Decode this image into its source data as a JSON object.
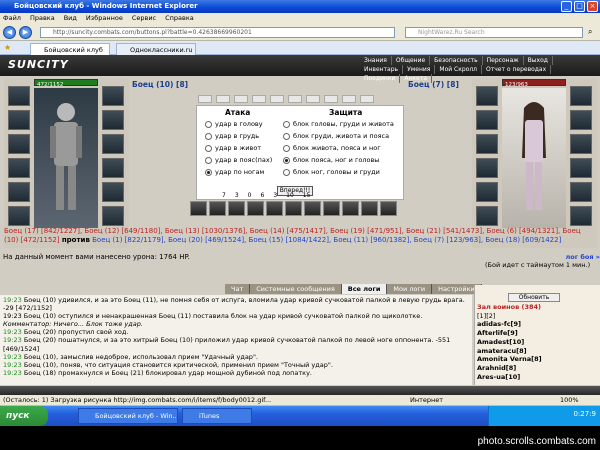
{
  "window": {
    "title": "Бойцовский клуб - Windows Internet Explorer"
  },
  "menu": [
    "Файл",
    "Правка",
    "Вид",
    "Избранное",
    "Сервис",
    "Справка"
  ],
  "address": {
    "url": "http://suncity.combats.com/buttons.pl?battle=0.42638669960201",
    "search_placeholder": "NightWarez.Ru Search"
  },
  "tabs": [
    {
      "label": "Бойцовский клуб"
    },
    {
      "label": "Одноклассники.ru"
    }
  ],
  "game": {
    "logo": "SUNCITY",
    "topnav": [
      "Знания",
      "Общение",
      "Безопасность",
      "Персонаж",
      "Выход",
      "Инвентарь",
      "Умения",
      "Мой Скролл",
      "Отчет о переводах",
      "Поединки",
      "Анкета"
    ],
    "left_hp": "472/1152",
    "right_hp": "123/963",
    "left_name": "Боец (10) [8]",
    "right_name": "Боец (7) [8]",
    "attack_title": "Атака",
    "defense_title": "Защита",
    "attacks": [
      "удар в голову",
      "удар в грудь",
      "удар в живот",
      "удар в пояс(пах)",
      "удар по ногам"
    ],
    "defenses": [
      "блок головы, груди и живота",
      "блок груди, живота и пояса",
      "блок живота, пояса и ног",
      "блок пояса, ног и головы",
      "блок ног, головы и груди"
    ],
    "fight_button": "Вперед!!!",
    "stats": [
      "7",
      "3",
      "0",
      "6",
      "3",
      "10",
      "15"
    ],
    "team_line1": "Боец (17) [842/1227], Боец (12) [649/1180], Боец (13) [1030/1376], Боец (14) [475/1417], Боец (19) [471/951], Боец (21) [541/1473], Боец (6) [494/1321], Боец",
    "team_line2_red": "(10) [472/1152]",
    "team_line2_vs": "против",
    "team_line2_blue": "Боец (1) [822/1179], Боец (20) [469/1524], Боец (15) [1084/1422], Боец (11) [960/1382], Боец (7) [123/963], Боец (18) [609/1422]",
    "damage": "На данный момент вами нанесено урона: 1764 HP.",
    "timeout_link": "лог боя »",
    "timeout": "(Бой идет с таймаутом 1 мин.)"
  },
  "chat_tabs": [
    "Чат",
    "Системные сообщения",
    "Все логи",
    "Мои логи",
    "Настройки"
  ],
  "chat": [
    {
      "time": "19:23",
      "text": "Боец (10) удивился, и за это Боец (11), не помня себя от испуга, вломила удар кривой сучковатой палкой в левую грудь врага. -29 [472/1152]"
    },
    {
      "time": "",
      "text": "19:23 Боец (10) оступился и ненакрашенная Боец (11) поставила блок на удар кривой сучковатой палкой по щиколотке."
    },
    {
      "time": "",
      "text": "Комментатор: Ничего... Блок тоже удар."
    },
    {
      "time": "19:23",
      "text": "Боец (20) пропустил свой ход."
    },
    {
      "time": "19:23",
      "text": "Боец (20) пошатнулся, и за это хитрый Боец (10) приложил удар кривой сучковатой палкой по левой ноге оппонента. -551 [469/1524]"
    },
    {
      "time": "19:23",
      "text": "Боец (10), замыслив недоброе, использовал прием \"Удачный удар\"."
    },
    {
      "time": "19:23",
      "text": "Боец (10), поняв, что ситуация становится критической, применил прием \"Точный удар\"."
    },
    {
      "time": "19:23",
      "text": "Боец (18) промахнулся и Боец (21) блокировал удар мощной дубиной под лопатку."
    }
  ],
  "side": {
    "refresh": "Обновить",
    "room": "Зал воинов (384)",
    "pages": "[1][2]",
    "players": [
      "adidas-fc[9]",
      "Afterlife[9]",
      "Amadest[10]",
      "amateracu[8]",
      "Amonita Verna[8]",
      "Arahnid[8]",
      "Ares-ua[10]"
    ]
  },
  "statusbar": {
    "text": "(Осталось: 1) Загрузка рисунка http://img.combats.com/i/items/f/body0012.gif...",
    "zone": "Интернет",
    "zoom": "100%"
  },
  "taskbar": {
    "start": "пуск",
    "items": [
      "Бойцовский клуб - Win...",
      "iTunes"
    ],
    "clock": "0:27:9"
  },
  "watermark": "photo.scrolls.combats.com"
}
